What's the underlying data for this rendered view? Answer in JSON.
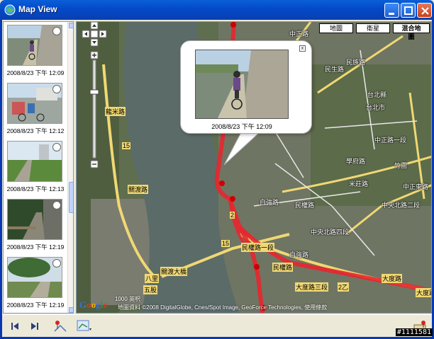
{
  "window": {
    "title": "Map View"
  },
  "thumbnails": [
    {
      "date": "2008/8/23 下午 12:09"
    },
    {
      "date": "2008/8/23 下午 12:12"
    },
    {
      "date": "2008/8/23 下午 12:13"
    },
    {
      "date": "2008/8/23 下午 12:19"
    },
    {
      "date": "2008/8/23 下午 12:19"
    }
  ],
  "map": {
    "types": [
      "地圖",
      "衛星",
      "混合地圖"
    ],
    "active_type": "混合地圖",
    "bubble": {
      "date": "2008/8/23 下午 12:09",
      "close": "x"
    },
    "labels": {
      "place1": "台北縣",
      "place2": "台北市",
      "road1": "民生路",
      "road2": "中正路",
      "road3": "米莊路",
      "road4": "學府路",
      "road5": "中央北路四段",
      "road6": "大度路三段",
      "road7": "民權路",
      "road8": "關渡大橋",
      "road9": "大度路",
      "road10": "中央北路二段",
      "road11": "自強路",
      "road12": "龍米路",
      "road13": "關渡路",
      "road14": "八里",
      "road15": "五股",
      "road16": "中正路一段",
      "road17": "竹圍",
      "road18": "中正東路",
      "road19": "民族路",
      "road20": "民權路一段",
      "road21": "大度路",
      "shield1": "15",
      "shield2": "15",
      "shield3": "2乙",
      "shield4": "2",
      "road22": "民權路",
      "road23": "自強路"
    },
    "scale": "1000 英呎",
    "copyright": "地圖資料 ©2008 DigitalGlobe, Cnes/Spot Image, GeoForce Technologies, 使用條款"
  },
  "watermark": "#1111581",
  "colors": {
    "titlebar": "#0349c9",
    "track": "#e8262d",
    "water": "#5b6b68",
    "land": "#5f6e4e",
    "road": "#f0d873"
  }
}
